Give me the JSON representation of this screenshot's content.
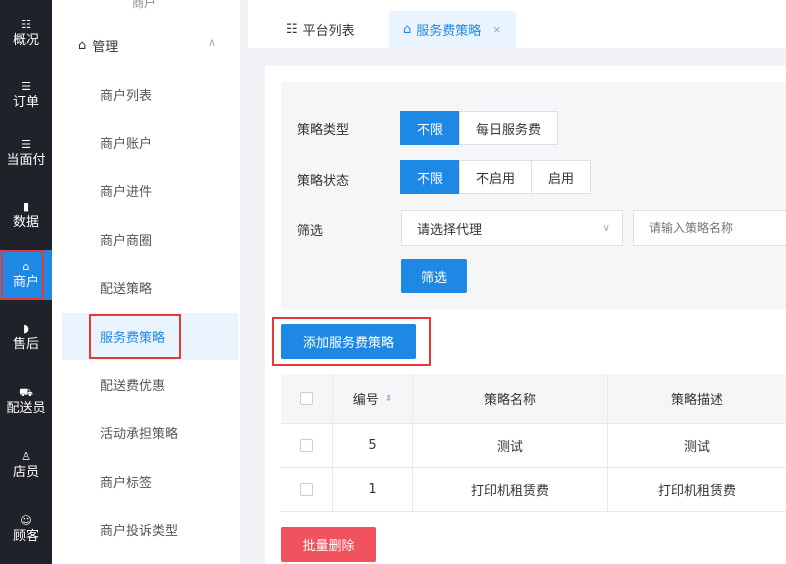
{
  "rail": [
    {
      "icon": "☷",
      "label": "概况"
    },
    {
      "icon": "☰",
      "label": "订单"
    },
    {
      "icon": "☰",
      "label": "当面付"
    },
    {
      "icon": "▮",
      "label": "数据"
    },
    {
      "icon": "⌂",
      "label": "商户"
    },
    {
      "icon": "◗",
      "label": "售后"
    },
    {
      "icon": "⛟",
      "label": "配送员"
    },
    {
      "icon": "♙",
      "label": "店员"
    },
    {
      "icon": "☺",
      "label": "顾客"
    }
  ],
  "submenu": {
    "cut_top": "商户",
    "group_label": "管理",
    "items": [
      "商户列表",
      "商户账户",
      "商户进件",
      "商户商圈",
      "配送策略",
      "服务费策略",
      "配送费优惠",
      "活动承担策略",
      "商户标签",
      "商户投诉类型"
    ]
  },
  "tabs": [
    {
      "label": "平台列表"
    },
    {
      "label": "服务费策略",
      "close": "×"
    }
  ],
  "filter": {
    "type_label": "策略类型",
    "type_options": [
      "不限",
      "每日服务费"
    ],
    "status_label": "策略状态",
    "status_options": [
      "不限",
      "不启用",
      "启用"
    ],
    "screen_label": "筛选",
    "agent_select": "请选择代理",
    "name_placeholder": "请输入策略名称",
    "screen_button": "筛选"
  },
  "add_button": "添加服务费策略",
  "table": {
    "columns": [
      "编号",
      "策略名称",
      "策略描述"
    ],
    "rows": [
      {
        "id": "5",
        "name": "测试",
        "desc": "测试"
      },
      {
        "id": "1",
        "name": "打印机租赁费",
        "desc": "打印机租赁费"
      }
    ]
  },
  "bulk_delete": "批量删除",
  "colors": {
    "accent": "#1e88e5",
    "danger": "#f0525e",
    "highlight": "#e53935",
    "rail": "#1f2329"
  }
}
